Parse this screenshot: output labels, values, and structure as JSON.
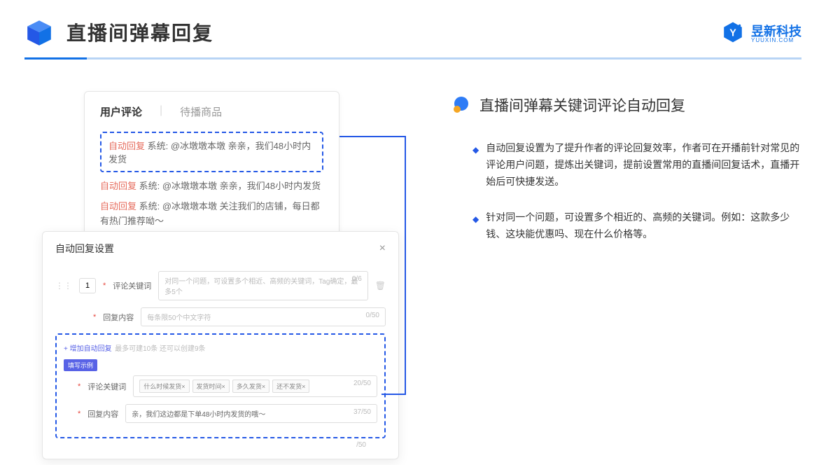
{
  "header": {
    "title": "直播间弹幕回复",
    "brand": "昱新科技",
    "brandSub": "YUUXIN.COM"
  },
  "panelTop": {
    "tab1": "用户评论",
    "tab2": "待播商品",
    "highlighted": {
      "tag": "自动回复",
      "text": " 系统: @冰墩墩本墩 亲亲，我们48小时内发货"
    },
    "line2": {
      "tag": "自动回复",
      "text": " 系统: @冰墩墩本墩 亲亲，我们48小时内发货"
    },
    "line3": {
      "tag": "自动回复",
      "text": " 系统: @冰墩墩本墩 关注我们的店铺，每日都有热门推荐呦～"
    }
  },
  "panelBottom": {
    "title": "自动回复设置",
    "num": "1",
    "row1": {
      "label": "评论关键词",
      "placeholder": "对同一个问题，可设置多个相近、高频的关键词，Tag确定，最多5个",
      "count": "0/6"
    },
    "row2": {
      "label": "回复内容",
      "placeholder": "每条限50个中文字符",
      "count": "0/50"
    },
    "addLink": "+ 增加自动回复",
    "addHint": "最多可建10条 还可以创建9条",
    "badge": "填写示例",
    "ex1": {
      "label": "评论关键词",
      "chip1": "什么时候发货×",
      "chip2": "发货时间×",
      "chip3": "多久发货×",
      "chip4": "还不发货×",
      "count": "20/50"
    },
    "ex2": {
      "label": "回复内容",
      "text": "亲，我们这边都是下单48小时内发货的哦～",
      "count": "37/50"
    },
    "extraCount": "/50"
  },
  "right": {
    "sectionTitle": "直播间弹幕关键词评论自动回复",
    "b1": "自动回复设置为了提升作者的评论回复效率，作者可在开播前针对常见的评论用户问题，提炼出关键词，提前设置常用的直播间回复话术，直播开始后可快捷发送。",
    "b2": "针对同一个问题，可设置多个相近的、高频的关键词。例如：这款多少钱、这块能优惠吗、现在什么价格等。"
  }
}
